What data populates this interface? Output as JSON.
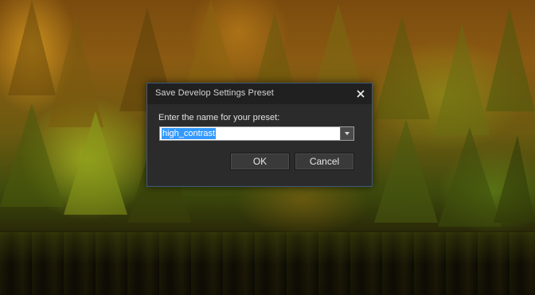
{
  "dialog": {
    "title": "Save Develop Settings Preset",
    "close_icon": "close-icon",
    "prompt_label": "Enter the name for your preset:",
    "preset_name_value": "high_contrast",
    "dropdown_icon": "chevron-down-icon",
    "ok_label": "OK",
    "cancel_label": "Cancel"
  },
  "colors": {
    "dialog_bg": "#2b2b2b",
    "titlebar_bg": "#202020",
    "selection": "#3399ff",
    "border": "#3e5a78"
  }
}
